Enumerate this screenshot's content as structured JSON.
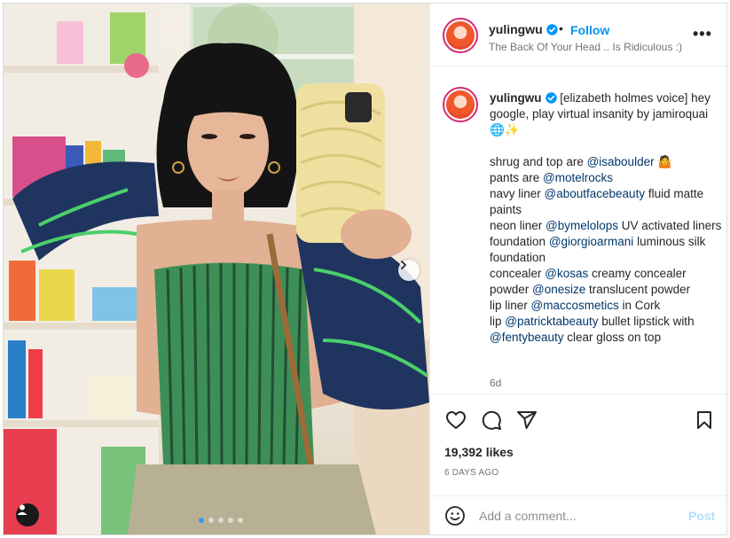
{
  "post": {
    "username": "yulingwu",
    "follow_label": "Follow",
    "separator": "•",
    "subtitle": "The Back Of Your Head .. Is Ridiculous :)",
    "more_label": "•••",
    "caption": [
      {
        "t": "text",
        "v": "[elizabeth holmes voice] hey google, play virtual insanity by jamiroquai 🌐✨\n\nshrug and top are "
      },
      {
        "t": "mention",
        "v": "@isaboulder"
      },
      {
        "t": "text",
        "v": " 🤷\npants are "
      },
      {
        "t": "mention",
        "v": "@motelrocks"
      },
      {
        "t": "text",
        "v": "\nnavy liner "
      },
      {
        "t": "mention",
        "v": "@aboutfacebeauty"
      },
      {
        "t": "text",
        "v": " fluid matte paints\nneon liner "
      },
      {
        "t": "mention",
        "v": "@bymelolops"
      },
      {
        "t": "text",
        "v": " UV activated liners\nfoundation "
      },
      {
        "t": "mention",
        "v": "@giorgioarmani"
      },
      {
        "t": "text",
        "v": " luminous silk foundation\nconcealer "
      },
      {
        "t": "mention",
        "v": "@kosas"
      },
      {
        "t": "text",
        "v": " creamy concealer\npowder "
      },
      {
        "t": "mention",
        "v": "@onesize"
      },
      {
        "t": "text",
        "v": " translucent powder\nlip liner "
      },
      {
        "t": "mention",
        "v": "@maccosmetics"
      },
      {
        "t": "text",
        "v": " in Cork\nlip "
      },
      {
        "t": "mention",
        "v": "@patricktabeauty"
      },
      {
        "t": "text",
        "v": " bullet lipstick with\n"
      },
      {
        "t": "mention",
        "v": "@fentybeauty"
      },
      {
        "t": "text",
        "v": " clear gloss on top"
      }
    ],
    "age": "6d",
    "likes": "19,392 likes",
    "date": "6 DAYS AGO",
    "comment_placeholder": "Add a comment...",
    "post_label": "Post",
    "carousel": {
      "count": 5,
      "active": 0
    }
  },
  "colors": {
    "accent": "#0095f6",
    "post_disabled": "#b2dffc",
    "mention": "#00376b",
    "muted": "#737373",
    "text": "#262626"
  },
  "icons": [
    "verified-badge-icon",
    "more-options-icon",
    "heart-icon",
    "comment-icon",
    "share-icon",
    "bookmark-icon",
    "emoji-icon",
    "next-arrow-icon",
    "tagged-user-icon"
  ]
}
